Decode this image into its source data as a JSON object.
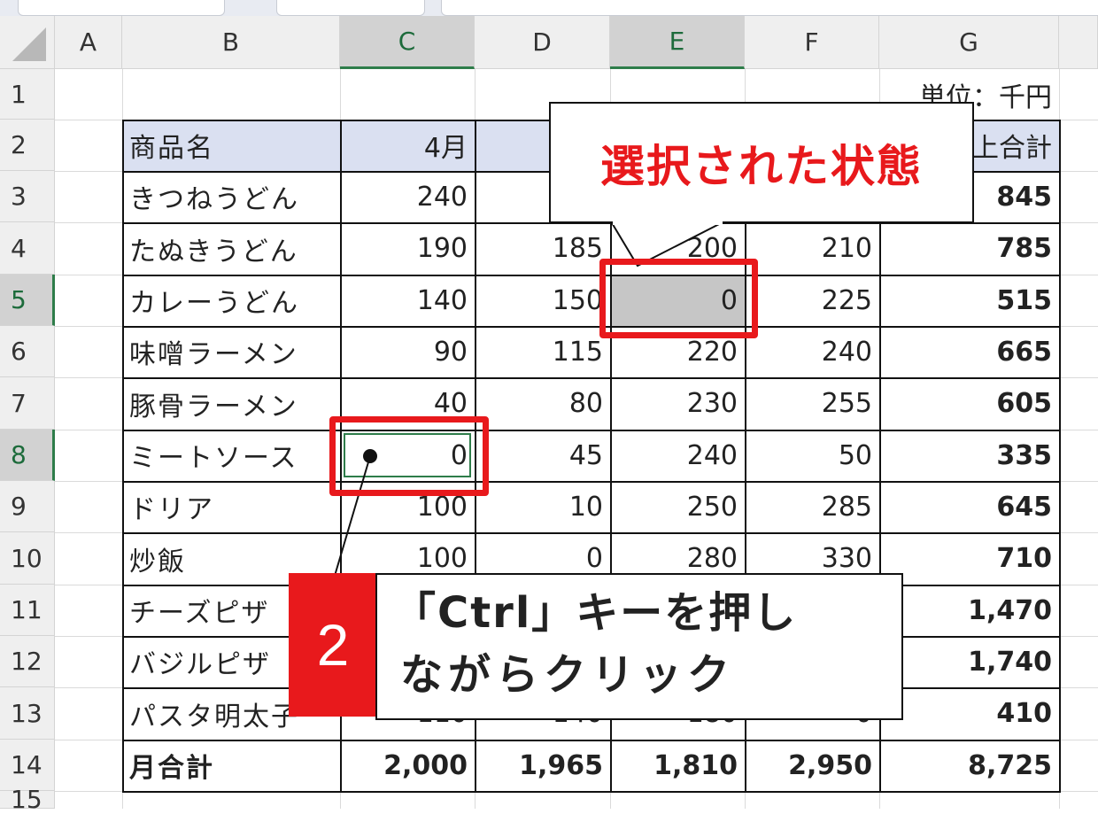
{
  "columns": [
    "A",
    "B",
    "C",
    "D",
    "E",
    "F",
    "G"
  ],
  "rows": [
    "1",
    "2",
    "3",
    "4",
    "5",
    "6",
    "7",
    "8",
    "9",
    "10",
    "11",
    "12",
    "13",
    "14",
    "15"
  ],
  "unit_label": "単位：千円",
  "header_row": [
    "商品名",
    "4月",
    "",
    "",
    "",
    "上合計"
  ],
  "table": [
    [
      "きつねうどん",
      "240",
      "",
      "",
      "",
      "845"
    ],
    [
      "たぬきうどん",
      "190",
      "185",
      "200",
      "210",
      "785"
    ],
    [
      "カレーうどん",
      "140",
      "150",
      "0",
      "225",
      "515"
    ],
    [
      "味噌ラーメン",
      "90",
      "115",
      "220",
      "240",
      "665"
    ],
    [
      "豚骨ラーメン",
      "40",
      "80",
      "230",
      "255",
      "605"
    ],
    [
      "ミートソース",
      "0",
      "45",
      "240",
      "50",
      "335"
    ],
    [
      "ドリア",
      "100",
      "10",
      "250",
      "285",
      "645"
    ],
    [
      "炒飯",
      "100",
      "0",
      "280",
      "330",
      "710"
    ],
    [
      "チーズピザ",
      "",
      "",
      "",
      "",
      "1,470"
    ],
    [
      "バジルピザ",
      "",
      "",
      "",
      "",
      "1,740"
    ],
    [
      "パスタ明太子",
      "110",
      "140",
      "180",
      "0",
      "410"
    ]
  ],
  "total_row": [
    "月合計",
    "2,000",
    "1,965",
    "1,810",
    "2,950",
    "8,725"
  ],
  "callout_top": {
    "text": "選択された状態"
  },
  "callout_bottom": {
    "step": "2",
    "line1": "「Ctrl」キーを押し",
    "line2": "ながらクリック"
  },
  "colors": {
    "accent_red": "#e8191c",
    "selected_fill": "#c6c6c6",
    "header_fill": "#dae0f1",
    "excel_green": "#2e7d4a"
  }
}
